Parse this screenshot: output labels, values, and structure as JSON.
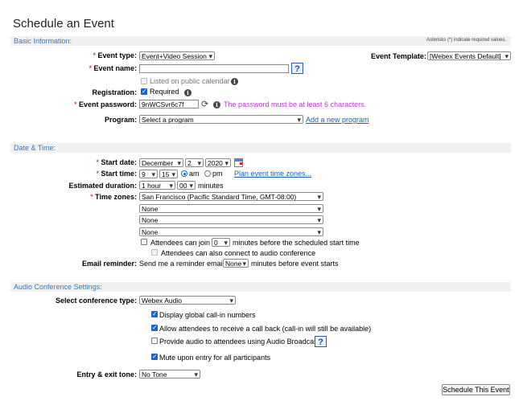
{
  "page": {
    "title": "Schedule an Event"
  },
  "basic": {
    "header": "Basic Information:",
    "required_note": "Asterisks (*) indicate required values.",
    "event_type_label": "Event type:",
    "event_type_value": "Event+Video Session",
    "event_template_label": "Event Template:",
    "event_template_value": "[Webex Events Default]",
    "event_name_label": "Event name:",
    "event_name_value": "",
    "listed_label": "Listed on public calendar",
    "registration_label": "Registration:",
    "required_label": "Required",
    "password_label": "Event password:",
    "password_value": "9nWCSvr6c7f",
    "password_hint": "The password must be at least 6 characters.",
    "program_label": "Program:",
    "program_value": "Select a program",
    "add_program_link": "Add a new program"
  },
  "datetime": {
    "header": "Date & Time:",
    "start_date_label": "Start date:",
    "month": "December",
    "day": "2",
    "year": "2020",
    "start_time_label": "Start time:",
    "hour": "9",
    "minute": "15",
    "am": "am",
    "pm": "pm",
    "plan_link": "Plan event time zones...",
    "duration_label": "Estimated duration:",
    "duration_hours": "1 hour",
    "duration_minutes": "00",
    "minutes_label": "minutes",
    "timezones_label": "Time zones:",
    "timezones": [
      "San Francisco (Pacific Standard Time, GMT-08:00)",
      "None",
      "None",
      "None"
    ],
    "join_prefix": "Attendees can join",
    "join_value": "0",
    "join_suffix": "minutes before the scheduled start time",
    "audio_connect": "Attendees can also connect to audio conference",
    "reminder_label": "Email reminder:",
    "reminder_prefix": "Send me a reminder email",
    "reminder_value": "None",
    "reminder_suffix": "minutes before event starts"
  },
  "audio": {
    "header": "Audio Conference Settings:",
    "conf_type_label": "Select conference type:",
    "conf_type_value": "Webex Audio",
    "opt_global": "Display global call-in numbers",
    "opt_callback": "Allow attendees to receive a call back (call-in will still be available)",
    "opt_broadcast": "Provide audio to attendees using Audio Broadcast",
    "opt_mute": "Mute upon entry for all participants",
    "tone_label": "Entry & exit tone:",
    "tone_value": "No Tone"
  },
  "footer": {
    "schedule_button": "Schedule This Event"
  },
  "glyphs": {
    "required": "*",
    "info": "i",
    "help": "?",
    "refresh": "⟳"
  }
}
